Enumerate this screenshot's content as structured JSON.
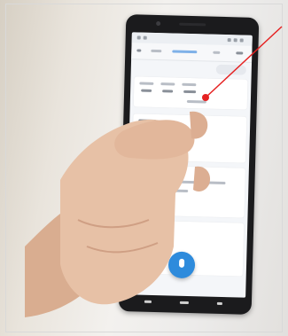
{
  "scene": {
    "subject": "hand-holding-smartphone",
    "colors": {
      "background": "#efefef",
      "phone_body": "#1b1b1d",
      "screen": "#f4f6f9",
      "mic_button": "#2e8bdc",
      "skin": "#e7c1a6",
      "annotation": "#e52222"
    }
  }
}
